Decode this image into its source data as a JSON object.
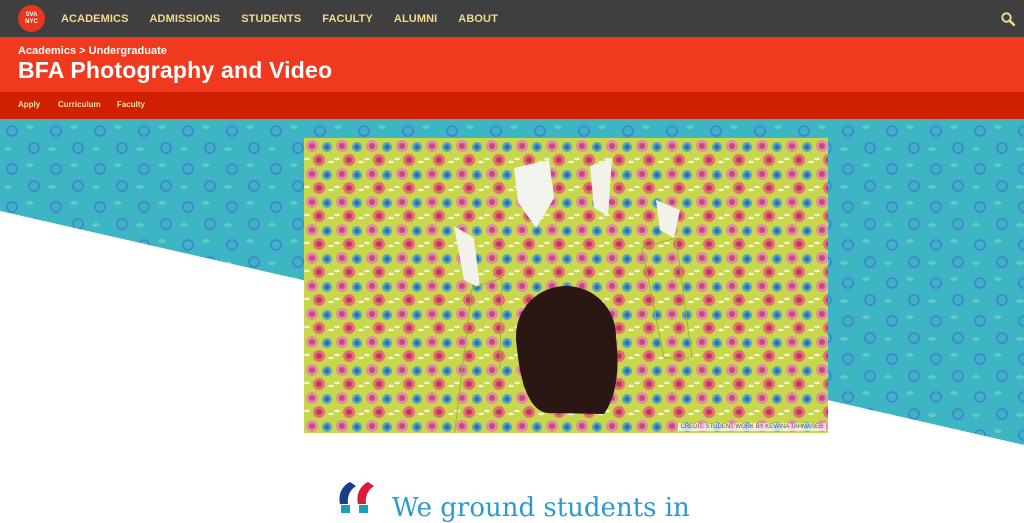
{
  "logo": {
    "line1": "SVA",
    "line2": "NYC"
  },
  "nav": {
    "items": [
      "ACADEMICS",
      "ADMISSIONS",
      "STUDENTS",
      "FACULTY",
      "ALUMNI",
      "ABOUT"
    ]
  },
  "header": {
    "breadcrumb_parent": "Academics",
    "breadcrumb_sep": ">",
    "breadcrumb_current": "Undergraduate",
    "title": "BFA Photography and Video"
  },
  "subnav": {
    "items": [
      "Apply",
      "Curriculum",
      "Faculty"
    ]
  },
  "hero": {
    "credit": "CREDIT: STUDENT WORK BY KEVANA TAHMASEB"
  },
  "intro": {
    "quote_text": "We ground students in"
  },
  "colors": {
    "nav_bg": "#3f3f3f",
    "nav_text": "#f2d98c",
    "header_red": "#ef3a1f",
    "subnav_red": "#d11f04",
    "teal": "#3bb5c2"
  }
}
